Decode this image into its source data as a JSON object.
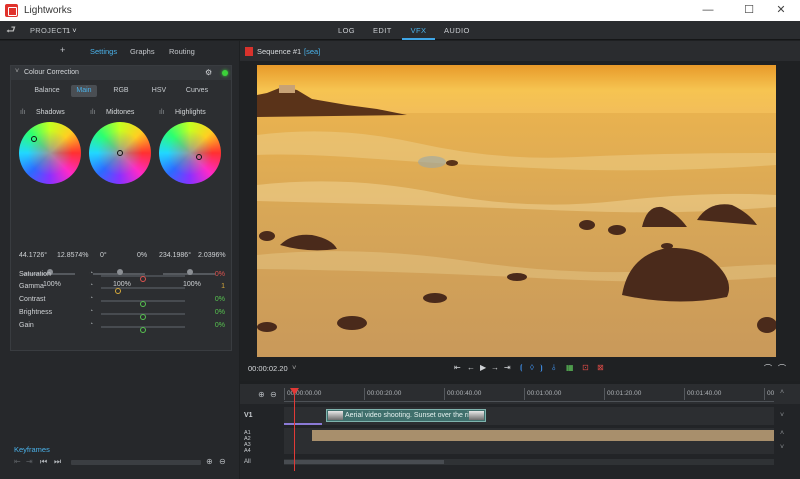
{
  "window": {
    "title": "Lightworks",
    "minimize": "—",
    "maximize": "☐",
    "close": "✕"
  },
  "menubar": {
    "project_label": "PROJECT",
    "project_num": "1 ˅",
    "tabs": [
      "LOG",
      "EDIT",
      "VFX",
      "AUDIO"
    ],
    "active_tab": "VFX"
  },
  "left": {
    "subtabs": {
      "add": "+",
      "settings": "Settings",
      "graphs": "Graphs",
      "routing": "Routing"
    },
    "effect": {
      "title": "Colour Correction",
      "modes": [
        "Balance",
        "Main",
        "RGB",
        "HSV",
        "Curves"
      ],
      "active_mode": "Main",
      "wheels": [
        {
          "label": "Shadows",
          "val_a": "44.1726°",
          "val_b": "12.8574%",
          "pct": "100%"
        },
        {
          "label": "Midtones",
          "val_a": "0°",
          "val_b": "0%",
          "pct": "100%"
        },
        {
          "label": "Highlights",
          "val_a": "234.1986°",
          "val_b": "2.0396%",
          "pct": "100%"
        }
      ],
      "properties": [
        {
          "label": "Saturation",
          "value": "0%",
          "color": "#e0534f",
          "level": 0.5
        },
        {
          "label": "Gamma",
          "value": "1",
          "color": "#d6a93a",
          "level": 0.2
        },
        {
          "label": "Contrast",
          "value": "0%",
          "color": "#57c450",
          "level": 0.5
        },
        {
          "label": "Brightness",
          "value": "0%",
          "color": "#57c450",
          "level": 0.5
        },
        {
          "label": "Gain",
          "value": "0%",
          "color": "#57c450",
          "level": 0.5
        }
      ]
    },
    "keyframes_label": "Keyframes"
  },
  "viewer": {
    "sequence_title": "Sequence #1",
    "sequence_sub": "[sea]",
    "timecode": "00:00:02.20",
    "timecode_chev": "˅"
  },
  "timeline": {
    "ruler": [
      "00:00:00.00",
      "00:00:20.00",
      "00:00:40.00",
      "00:01:00.00",
      "00:01:20.00",
      "00:01:40.00",
      "00:02:00.0"
    ],
    "tracks": {
      "v1": "V1",
      "a1": "A1",
      "a2": "A2",
      "a3": "A3",
      "a4": "A4",
      "all": "All"
    },
    "clip_label": "Aerial video shooting. Sunset over the ri"
  },
  "colors": {
    "accent": "#4ab2ea",
    "record": "#e13a37",
    "clip_video": "#3f6f6c",
    "clip_audio": "#a88f6c"
  }
}
